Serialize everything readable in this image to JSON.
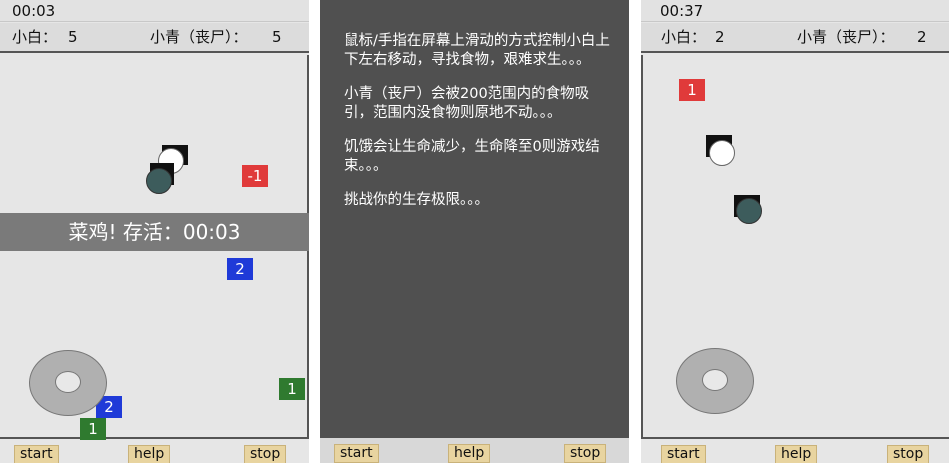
{
  "left": {
    "time": "00:03",
    "player_label": "小白：",
    "player_score": "5",
    "zombie_label": "小青（丧尸）：",
    "zombie_score": "5",
    "banner": "菜鸡! 存活：00:03",
    "foods": [
      "-1",
      "2",
      "2",
      "1",
      "1"
    ]
  },
  "middle": {
    "help": [
      "鼠标/手指在屏幕上滑动的方式控制小白上下左右移动，寻找食物，艰难求生。。。",
      "小青（丧尸）会被200范围内的食物吸引，范围内没食物则原地不动。。。",
      "饥饿会让生命减少，生命降至0则游戏结束。。。",
      "挑战你的生存极限。。。"
    ]
  },
  "right": {
    "time": "00:37",
    "player_label": "小白：",
    "player_score": "2",
    "zombie_label": "小青（丧尸）：",
    "zombie_score": "2",
    "foods": [
      "1"
    ]
  },
  "buttons": {
    "start": "start",
    "help": "help",
    "stop": "stop"
  },
  "colors": {
    "food_red": "#e03a3a",
    "food_blue": "#1f3ad8",
    "food_green": "#2f7a2f",
    "button_bg": "#e8d4a0",
    "help_bg": "#505050"
  }
}
